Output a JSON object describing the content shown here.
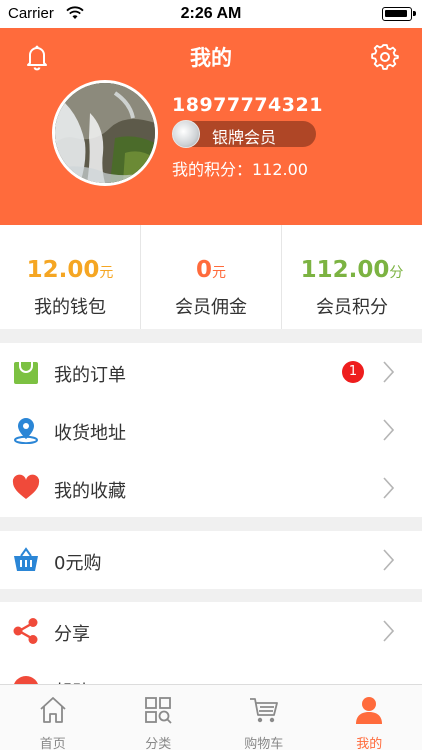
{
  "status_bar": {
    "carrier": "Carrier",
    "time": "2:26 AM"
  },
  "header": {
    "title": "我的",
    "phone": "18977774321",
    "member_level": "银牌会员",
    "points_line": "我的积分：112.00"
  },
  "stats": [
    {
      "value": "12.00",
      "unit": "元",
      "label": "我的钱包",
      "color": "#f5a623"
    },
    {
      "value": "0",
      "unit": "元",
      "label": "会员佣金",
      "color": "#ff6b3c"
    },
    {
      "value": "112.00",
      "unit": "分",
      "label": "会员积分",
      "color": "#7cb342"
    }
  ],
  "menu": {
    "orders": {
      "label": "我的订单",
      "badge": "1",
      "icon": "shopping-bag-icon"
    },
    "address": {
      "label": "收货地址",
      "icon": "location-pin-icon"
    },
    "favorites": {
      "label": "我的收藏",
      "icon": "heart-icon"
    },
    "zero_buy": {
      "label": "0元购",
      "icon": "basket-icon"
    },
    "share": {
      "label": "分享",
      "icon": "share-icon"
    },
    "help": {
      "label": "帮助",
      "icon": "help-icon"
    }
  },
  "tabbar": {
    "home": "首页",
    "category": "分类",
    "cart": "购物车",
    "mine": "我的"
  },
  "colors": {
    "accent": "#ff6b3c",
    "green": "#7cb342",
    "blue": "#2b86d6",
    "red": "#f04a3a"
  }
}
